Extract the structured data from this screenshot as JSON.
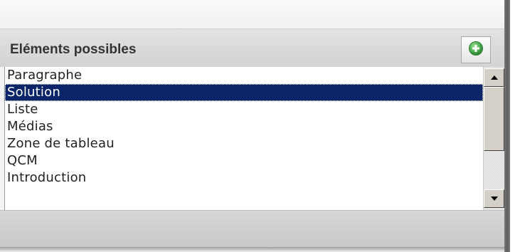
{
  "panel": {
    "title": "Eléments possibles",
    "add_icon": "plus-circle-icon",
    "accent_color": "#4caf50"
  },
  "list": {
    "selected_index": 1,
    "selection_color": "#0a246a",
    "items": [
      {
        "label": "Paragraphe"
      },
      {
        "label": "Solution"
      },
      {
        "label": "Liste"
      },
      {
        "label": "Médias"
      },
      {
        "label": "Zone de tableau"
      },
      {
        "label": "QCM"
      },
      {
        "label": "Introduction"
      }
    ]
  },
  "scrollbar": {
    "up_icon": "arrow-up-icon",
    "down_icon": "arrow-down-icon",
    "thumb_position_fraction": 0
  }
}
